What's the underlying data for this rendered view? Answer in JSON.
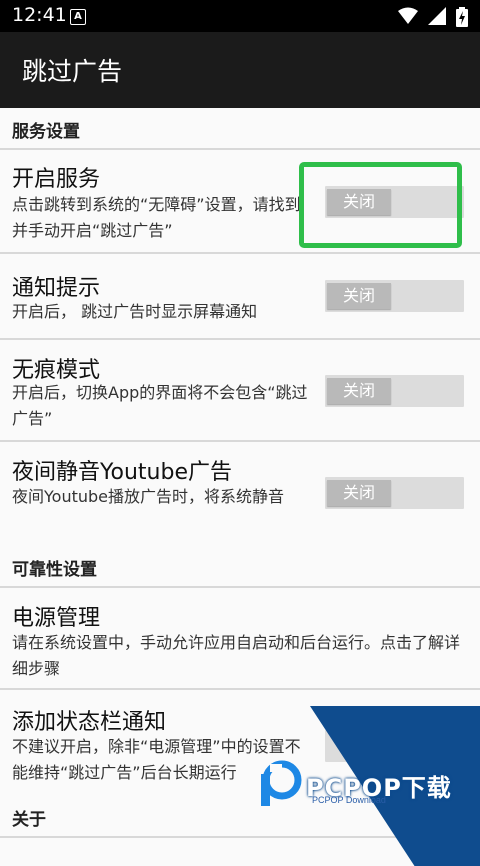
{
  "status_bar": {
    "time": "12:41",
    "notification_icon": "A",
    "icons": [
      "wifi-icon",
      "signal-icon",
      "battery-charging-icon"
    ]
  },
  "app_bar": {
    "title": "跳过广告"
  },
  "sections": {
    "service_settings": "服务设置",
    "reliability_settings": "可靠性设置",
    "about": "关于"
  },
  "items": {
    "enable_service": {
      "title": "开启服务",
      "desc": "点击跳转到系统的“无障碍”设置，请找到并手动开启“跳过广告”",
      "toggle": "关闭",
      "enabled": false
    },
    "notification_hint": {
      "title": "通知提示",
      "desc": "开启后， 跳过广告时显示屏幕通知",
      "toggle": "关闭",
      "enabled": false
    },
    "traceless_mode": {
      "title": "无痕模式",
      "desc": "开启后，切换App的界面将不会包含“跳过广告”",
      "toggle": "关闭",
      "enabled": false
    },
    "night_mute": {
      "title": "夜间静音Youtube广告",
      "desc": "夜间Youtube播放广告时，将系统静音",
      "toggle": "关闭",
      "enabled": false
    },
    "power_management": {
      "title": "电源管理",
      "desc": "请在系统设置中，手动允许应用自启动和后台运行。点击了解详细步骤"
    },
    "status_bar_notification": {
      "title": "添加状态栏通知",
      "desc": "不建议开启，除非“电源管理”中的设置不能维持“跳过广告”后台长期运行"
    }
  },
  "watermark": {
    "brand": "PCPOP下载",
    "sub": "PCPOP Download"
  },
  "colors": {
    "app_bar": "#1b1b1b",
    "highlight": "#2fbe4a",
    "toggle_track": "#dcdcdc",
    "toggle_thumb": "#b9b9b9",
    "watermark": "#0f4c8e"
  }
}
